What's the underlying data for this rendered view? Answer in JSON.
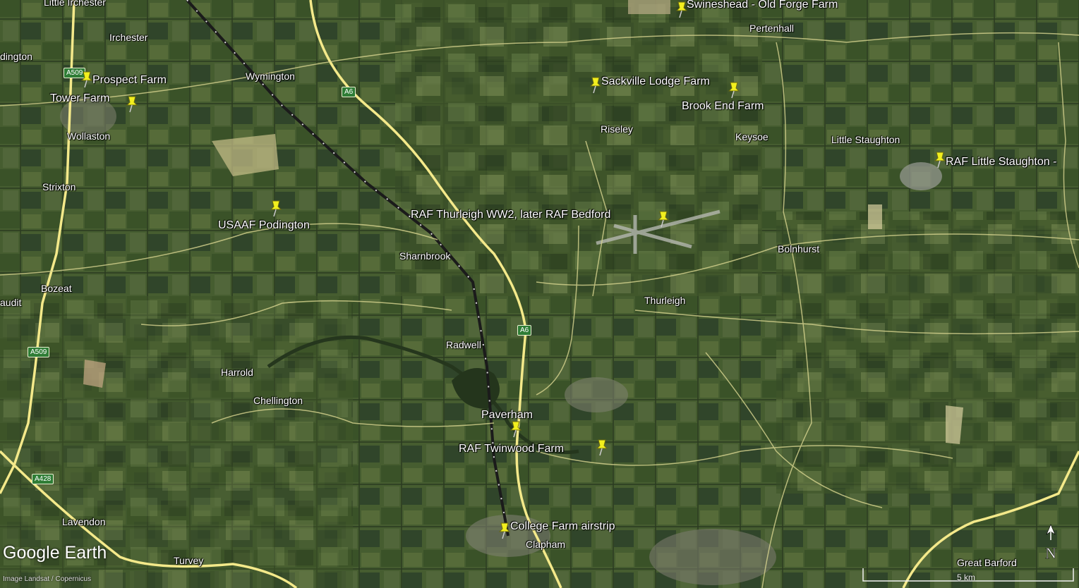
{
  "map": {
    "logo": "Google Earth",
    "credit": "Image Landsat / Copernicus",
    "scale_label": "5 km",
    "north_label": "N"
  },
  "pins": [
    {
      "id": "swineshead",
      "label": "Swineshead - Old Forge Farm"
    },
    {
      "id": "prospect",
      "label": "Prospect Farm"
    },
    {
      "id": "tower",
      "label": "Tower Farm"
    },
    {
      "id": "sackville",
      "label": "Sackville Lodge Farm"
    },
    {
      "id": "brook-end",
      "label": "Brook End Farm"
    },
    {
      "id": "little-staughton",
      "label": "RAF Little Staughton -"
    },
    {
      "id": "podington",
      "label": "USAAF Podington"
    },
    {
      "id": "thurleigh",
      "label": "RAF Thurleigh WW2, later RAF Bedford"
    },
    {
      "id": "paverham",
      "label": "Paverham"
    },
    {
      "id": "twinwood",
      "label": "RAF Twinwood Farm"
    },
    {
      "id": "college",
      "label": "College Farm airstrip"
    }
  ],
  "towns": [
    "Little Irchester",
    "Irchester",
    "Wymington",
    "Pertenhall",
    "Riseley",
    "Keysoe",
    "Little Staughton",
    "Wollaston",
    "Strixton",
    "Sharnbrook",
    "Bolnhurst",
    "Bozeat",
    "audit",
    "Thurleigh",
    "Radwell",
    "Harrold",
    "Chellington",
    "Lavendon",
    "Turvey",
    "Clapham",
    "Great Barford",
    "dington"
  ],
  "roads": [
    "A509",
    "A6",
    "A6",
    "A509",
    "A428"
  ],
  "colors": {
    "pin": "#f2ef1e",
    "road": "#f4e98a",
    "field_dark": "#2e4222",
    "field_light": "#6d7f45"
  }
}
